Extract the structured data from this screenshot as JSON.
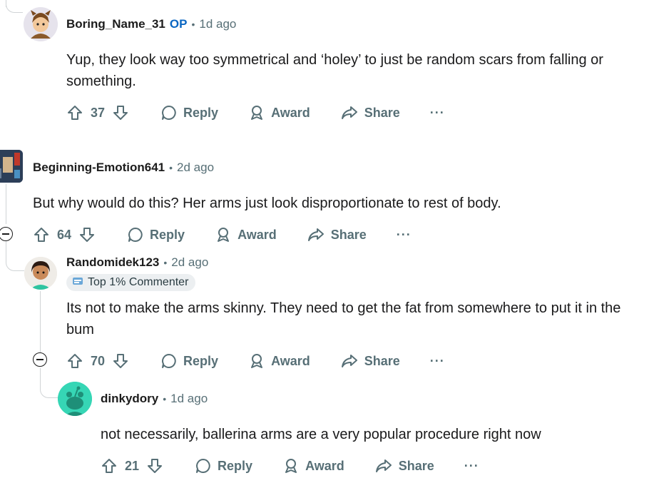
{
  "comments": [
    {
      "author": "Boring_Name_31",
      "op_badge": "OP",
      "time": "1d ago",
      "body": "Yup, they look way too symmetrical and ‘holey’ to just be random scars from falling or something.",
      "votes": "37",
      "reply": "Reply",
      "award": "Award",
      "share": "Share",
      "more": "···"
    },
    {
      "author": "Beginning-Emotion641",
      "time": "2d ago",
      "body": "But why would do this? Her arms just look disproportionate to rest of body.",
      "votes": "64",
      "reply": "Reply",
      "award": "Award",
      "share": "Share",
      "more": "···"
    },
    {
      "author": "Randomidek123",
      "time": "2d ago",
      "flair": "Top 1% Commenter",
      "body": "Its not to make the arms skinny. They need to get the fat from somewhere to put it in the bum",
      "votes": "70",
      "reply": "Reply",
      "award": "Award",
      "share": "Share",
      "more": "···"
    },
    {
      "author": "dinkydory",
      "time": "1d ago",
      "body": "not necessarily, ballerina arms are a very popular procedure right now",
      "votes": "21",
      "reply": "Reply",
      "award": "Award",
      "share": "Share",
      "more": "···"
    }
  ],
  "colors": {
    "op": "#0a66c2",
    "muted": "#576f76",
    "thread": "#d0d4d6",
    "avatar_teal": "#36d6b5"
  }
}
